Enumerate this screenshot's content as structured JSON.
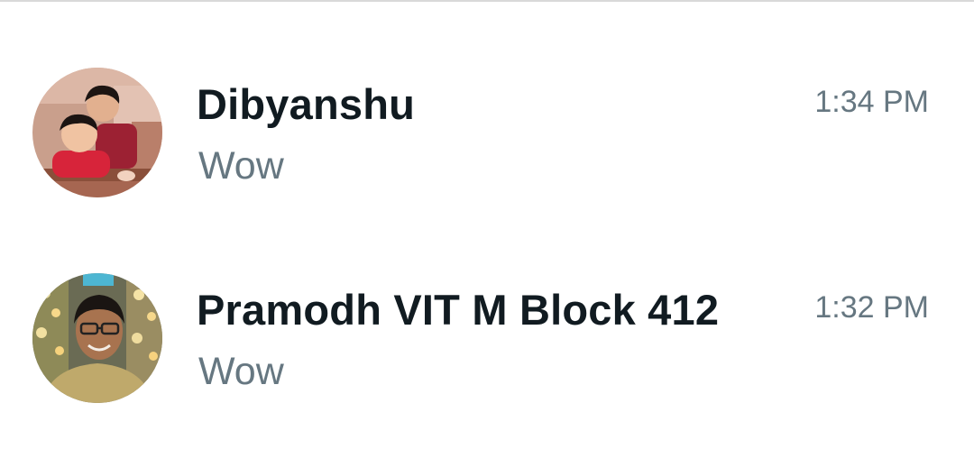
{
  "chats": [
    {
      "name": "Dibyanshu",
      "preview": "Wow",
      "time": "1:34 PM"
    },
    {
      "name": "Pramodh VIT M Block 412",
      "preview": "Wow",
      "time": "1:32 PM"
    }
  ]
}
